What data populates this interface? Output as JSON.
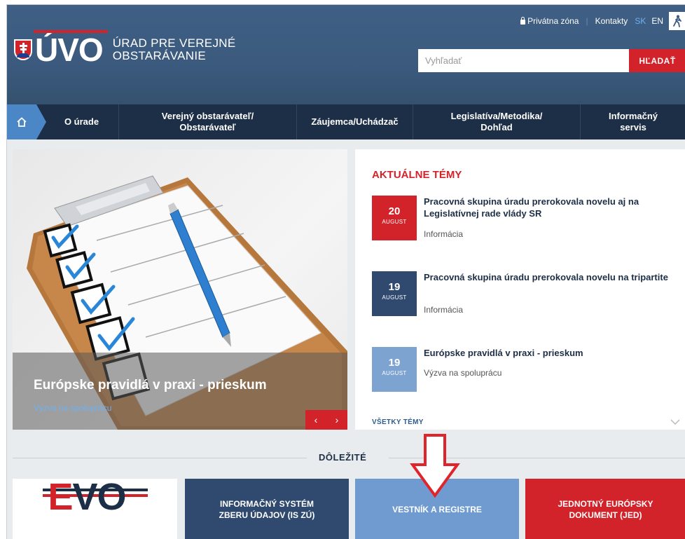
{
  "topbar": {
    "private_zone": "Privátna zóna",
    "separator": "|",
    "contacts": "Kontakty",
    "lang_sk": "SK",
    "lang_en": "EN"
  },
  "logo": {
    "abbr": "ÚVO",
    "name_line1": "ÚRAD PRE VEREJNÉ",
    "name_line2": "OBSTARÁVANIE"
  },
  "search": {
    "placeholder": "Vyhľadať",
    "button": "HĽADAŤ"
  },
  "nav": [
    {
      "label": "O úrade"
    },
    {
      "label": "Verejný obstarávateľ/ Obstarávateľ"
    },
    {
      "label": "Záujemca/Uchádzač"
    },
    {
      "label": "Legislatíva/Metodika/ Dohľad"
    },
    {
      "label": "Informačný servis"
    }
  ],
  "slider": {
    "title": "Európske pravidlá v praxi - prieskum",
    "subtitle": "Výzva na spoluprácu",
    "prev": "‹",
    "next": "›"
  },
  "news": {
    "heading": "AKTUÁLNE TÉMY",
    "items": [
      {
        "day": "20",
        "month": "AUGUST",
        "title": "Pracovná skupina úradu prerokovala novelu aj na Legislatívnej rade vlády SR",
        "category": "Informácia",
        "color": "#d3232a"
      },
      {
        "day": "19",
        "month": "AUGUST",
        "title": "Pracovná skupina úradu prerokovala novelu na tripartite",
        "category": "Informácia",
        "color": "#2f4a6e"
      },
      {
        "day": "19",
        "month": "AUGUST",
        "title": "Európske pravidlá v praxi - prieskum",
        "category": "Výzva na spoluprácu",
        "color": "#7da3d1"
      }
    ],
    "all_topics": "VŠETKY TÉMY"
  },
  "important": {
    "label": "DÔLEŽITÉ"
  },
  "tiles": [
    {
      "label": "EVO"
    },
    {
      "label": "INFORMAČNÝ SYSTÉM ZBERU ÚDAJOV (IS ZÚ)"
    },
    {
      "label": "VESTNÍK A REGISTRE"
    },
    {
      "label": "JEDNOTNÝ EURÓPSKY DOKUMENT (JED)"
    }
  ],
  "colors": {
    "header_blue": "#3b5a7e",
    "nav_dark": "#1d2f46",
    "accent_red": "#d3232a",
    "light_blue": "#6f9bd1"
  }
}
